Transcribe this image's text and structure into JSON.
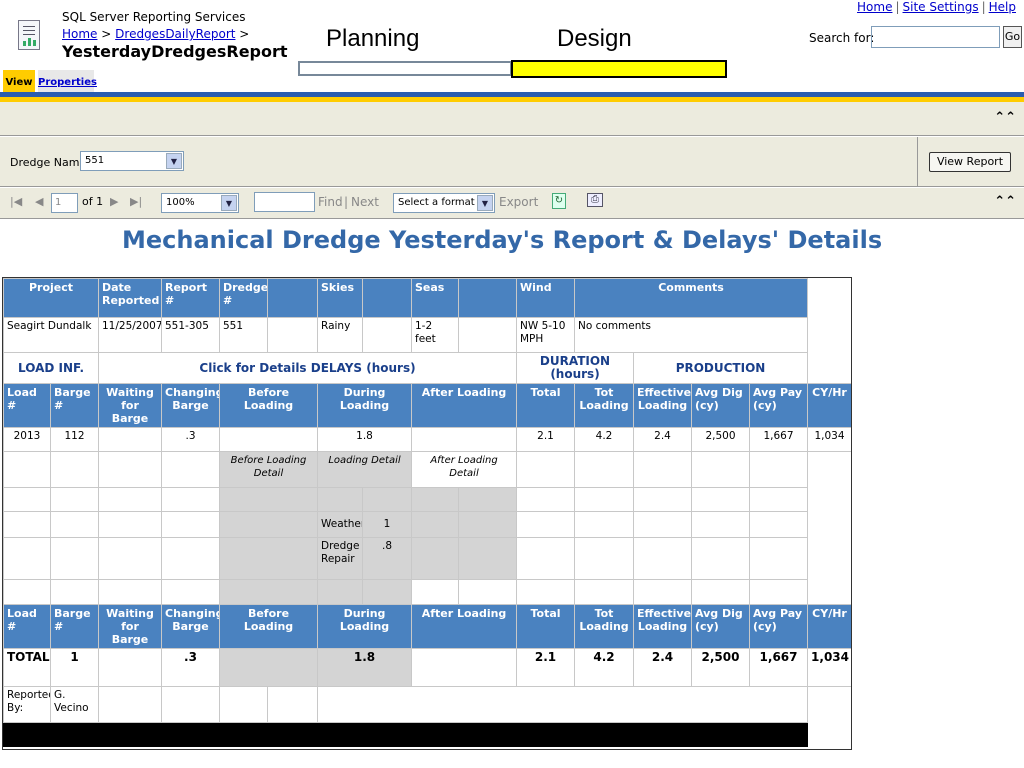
{
  "header": {
    "app_title": "SQL Server Reporting Services",
    "breadcrumb_home": "Home",
    "breadcrumb_sep": ">",
    "breadcrumb_folder": "DredgesDailyReport",
    "report_name": "YesterdayDredgesReport",
    "top_links": [
      "Home",
      "Site Settings",
      "Help"
    ],
    "search_label": "Search for:",
    "search_value": "",
    "go_label": "Go"
  },
  "progress": {
    "planning_label": "Planning",
    "design_label": "Design",
    "design_color": "#ffff00"
  },
  "tabs": {
    "view": "View",
    "properties": "Properties"
  },
  "parameters": {
    "dredge_label": "Dredge Name",
    "dredge_value": "551",
    "view_report_label": "View Report"
  },
  "toolbar": {
    "page_value": "1",
    "page_of": "of 1",
    "zoom_value": "100%",
    "find_label": "Find",
    "find_sep": "|",
    "next_label": "Next",
    "format_value": "Select a format",
    "export_label": "Export"
  },
  "report": {
    "title": "Mechanical Dredge Yesterday's Report & Delays' Details",
    "header_row": [
      "Project",
      "Date Reported",
      "Report #",
      "Dredge #",
      "",
      "Skies",
      "",
      "Seas",
      "",
      "Wind",
      "Comments"
    ],
    "info_row": [
      "Seagirt Dundalk",
      "11/25/2007",
      "551-305",
      "551",
      "",
      "Rainy",
      "",
      "1-2 feet",
      "",
      "NW 5-10 MPH",
      "No comments"
    ],
    "sections": {
      "load_inf": "LOAD INF.",
      "delays": "Click for Details DELAYS (hours)",
      "duration": "DURATION (hours)",
      "production": "PRODUCTION"
    },
    "col_headers": [
      "Load #",
      "Barge #",
      "Waiting for Barge",
      "Changing Barge",
      "Before Loading",
      "During Loading",
      "After Loading",
      "Total",
      "Tot Loading",
      "Effective Loading",
      "Avg Dig (cy)",
      "Avg Pay (cy)",
      "CY/Hr"
    ],
    "data_row": [
      "2013",
      "112",
      "",
      ".3",
      "",
      "1.8",
      "",
      "2.1",
      "4.2",
      "2.4",
      "2,500",
      "1,667",
      "1,034"
    ],
    "detail_headers": [
      "Before Loading Detail",
      "Loading Detail",
      "After Loading Detail"
    ],
    "loading_details": [
      {
        "label": "Weather",
        "value": "1"
      },
      {
        "label": "Dredge Repair",
        "value": ".8"
      }
    ],
    "totals_row": [
      "TOTALS",
      "1",
      "",
      ".3",
      "",
      "1.8",
      "",
      "2.1",
      "4.2",
      "2.4",
      "2,500",
      "1,667",
      "1,034"
    ],
    "reported_by_label": "Reported By:",
    "reported_by_value": "G. Vecino"
  }
}
